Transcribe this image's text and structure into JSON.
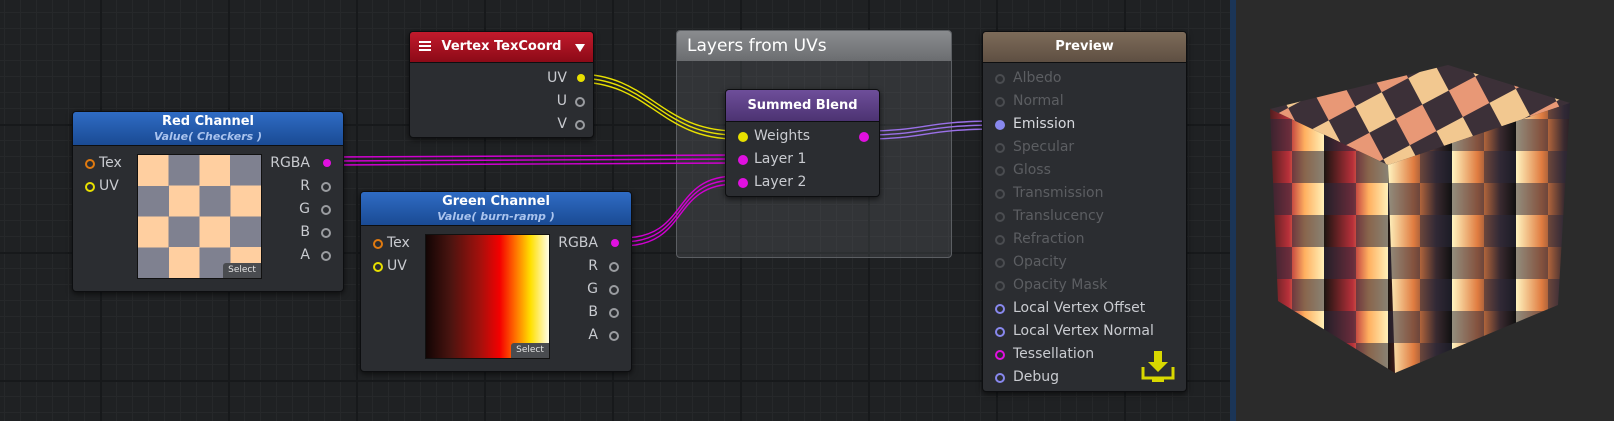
{
  "colors": {
    "header_blue": "#2f6cc4",
    "header_red": "#c21a2c",
    "header_purple": "#6e4e9a",
    "header_brown": "#7d6b59",
    "pin_magenta": "#e010e0",
    "pin_yellow": "#e8e000",
    "pin_orange": "#e07a10",
    "pin_blue": "#8888ee"
  },
  "nodes": {
    "vertex_texcoord": {
      "title": "Vertex TexCoord",
      "outputs": [
        "UV",
        "U",
        "V"
      ]
    },
    "red_channel": {
      "title": "Red Channel",
      "subtitle": "Value( Checkers )",
      "inputs": [
        "Tex",
        "UV"
      ],
      "outputs": [
        "RGBA",
        "R",
        "G",
        "B",
        "A"
      ],
      "select_label": "Select"
    },
    "green_channel": {
      "title": "Green Channel",
      "subtitle": "Value( burn-ramp )",
      "inputs": [
        "Tex",
        "UV"
      ],
      "outputs": [
        "RGBA",
        "R",
        "G",
        "B",
        "A"
      ],
      "select_label": "Select"
    },
    "summed_blend": {
      "title": "Summed Blend",
      "inputs": [
        "Weights",
        "Layer 1",
        "Layer 2"
      ]
    },
    "preview": {
      "title": "Preview",
      "inputs": [
        "Albedo",
        "Normal",
        "Emission",
        "Specular",
        "Gloss",
        "Transmission",
        "Translucency",
        "Refraction",
        "Opacity",
        "Opacity Mask",
        "Local Vertex Offset",
        "Local Vertex Normal",
        "Tessellation",
        "Debug"
      ]
    }
  },
  "group": {
    "title": "Layers from UVs"
  },
  "icons": {
    "menu": "hamburger-menu-icon",
    "dropdown": "triangle-down-icon",
    "download": "download-tray-icon"
  }
}
